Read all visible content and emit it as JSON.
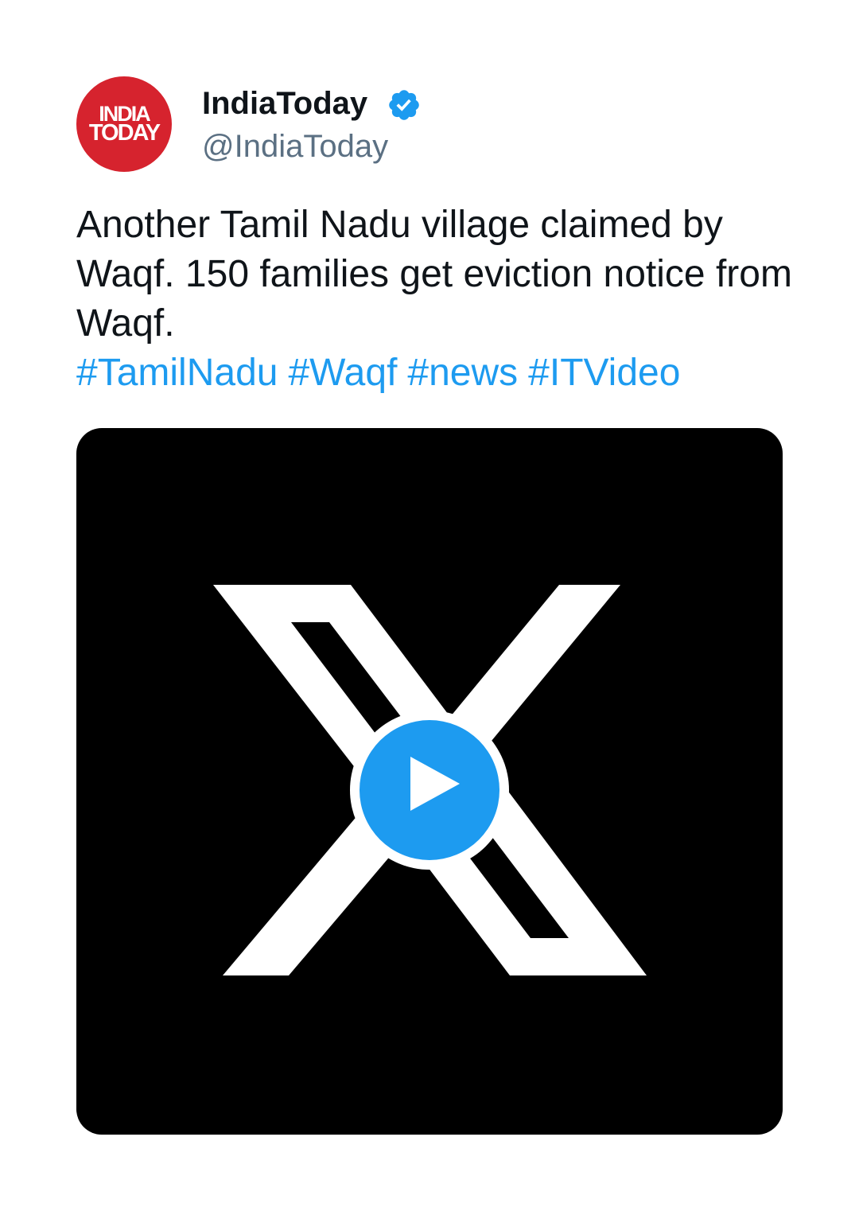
{
  "author": {
    "logo_line1": "INDIA",
    "logo_line2": "TODAY",
    "display_name": "IndiaToday",
    "handle": "@IndiaToday",
    "verified": true,
    "avatar_color": "#d6232e"
  },
  "tweet": {
    "text": "Another Tamil Nadu village claimed by Waqf. 150 families get eviction notice from Waqf.",
    "hashtags": [
      "#TamilNadu",
      "#Waqf",
      "#news",
      "#ITVideo"
    ]
  },
  "media": {
    "type": "video",
    "thumbnail_icon": "x-logo-icon",
    "play_icon": "play-icon",
    "background": "#000000"
  },
  "colors": {
    "accent": "#1d9bf0",
    "text": "#0f1419",
    "secondary_text": "#5b7083"
  }
}
